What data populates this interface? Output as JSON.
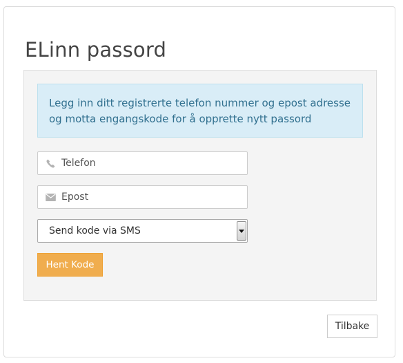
{
  "page": {
    "title": "ELinn passord"
  },
  "form": {
    "info_text": "Legg inn ditt registrerte telefon nummer og epost adresse og motta engangskode for å opprette nytt passord",
    "phone": {
      "placeholder": "Telefon",
      "icon": "phone-icon"
    },
    "email": {
      "placeholder": "Epost",
      "icon": "envelope-icon"
    },
    "delivery_method": {
      "selected": "Send kode via SMS"
    },
    "submit_label": "Hent Kode"
  },
  "footer": {
    "back_label": "Tilbake"
  },
  "colors": {
    "accent_orange": "#f0ad4e",
    "info_background": "#d9edf7",
    "info_text": "#31708f",
    "well_background": "#f4f4f4"
  }
}
